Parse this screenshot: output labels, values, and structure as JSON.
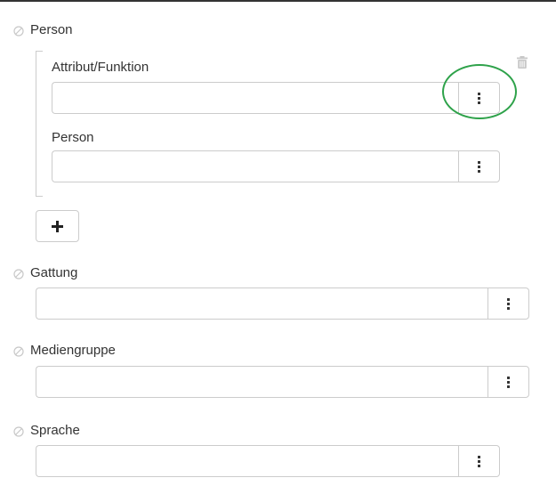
{
  "fields": {
    "person": {
      "label": "Person",
      "entry": {
        "attribute_label": "Attribut/Funktion",
        "attribute_value": "",
        "person_label": "Person",
        "person_value": ""
      }
    },
    "gattung": {
      "label": "Gattung",
      "value": ""
    },
    "mediengruppe": {
      "label": "Mediengruppe",
      "value": ""
    },
    "sprache": {
      "label": "Sprache",
      "value": ""
    }
  },
  "icons": {
    "unset": "ban-icon",
    "menu": "kebab-menu-icon",
    "delete": "trash-icon",
    "add": "plus-icon"
  },
  "colors": {
    "highlight": "#2ea24a",
    "border": "#cccccc",
    "muted_icon": "#c8c8c8",
    "text": "#333333"
  }
}
